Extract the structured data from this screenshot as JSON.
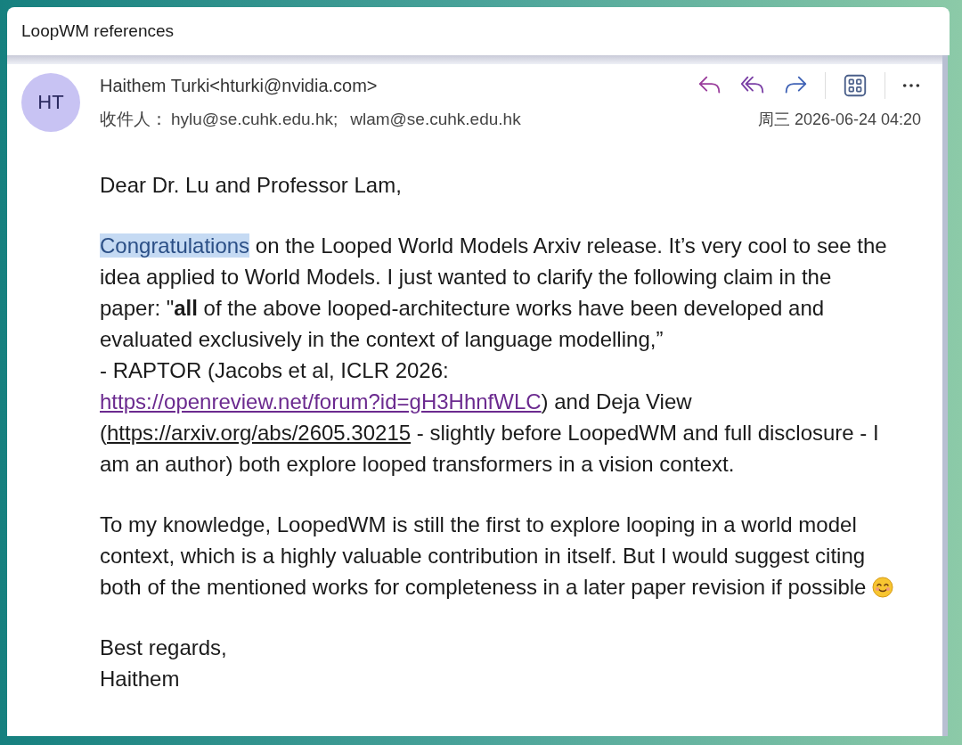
{
  "window": {
    "title": "LoopWM references"
  },
  "message": {
    "sender": {
      "initials": "HT",
      "name": "Haithem Turki<hturki@nvidia.com>"
    },
    "recipients_label": "收件人：",
    "recipients": [
      "hylu@se.cuhk.edu.hk;",
      "wlam@se.cuhk.edu.hk"
    ],
    "date": "周三 2026-06-24 04:20",
    "body": [
      {
        "segments": [
          {
            "kind": "text",
            "text": "Dear Dr. Lu and Professor Lam,"
          }
        ]
      },
      {
        "segments": [
          {
            "kind": "highlight",
            "text": "Congratulations"
          },
          {
            "kind": "text",
            "text": " on the Looped World Models Arxiv release. It’s very cool to see the idea applied to World Models. I just wanted to clarify the following claim in the paper: \"**all** of the above looped-architecture works have been developed and evaluated exclusively in the context of language modelling,”"
          },
          {
            "kind": "break"
          },
          {
            "kind": "text",
            "text": "- RAPTOR (Jacobs et al, ICLR 2026: "
          },
          {
            "kind": "link",
            "text": "https://openreview.net/forum?id=gH3HhnfWLC",
            "visited": true
          },
          {
            "kind": "text",
            "text": ") and Deja View ("
          },
          {
            "kind": "link",
            "text": "https://arxiv.org/abs/2605.30215",
            "visited": false
          },
          {
            "kind": "text",
            "text": " - slightly before LoopedWM and full disclosure - I am an author) both explore looped transformers in a vision context."
          }
        ]
      },
      {
        "segments": [
          {
            "kind": "text",
            "text": "To my knowledge, LoopedWM is still the first to explore looping in a world model context, which is a highly valuable contribution in itself. But I would suggest citing both of the mentioned works for completeness in a later paper revision if possible "
          },
          {
            "kind": "emoji"
          }
        ]
      },
      {
        "segments": [
          {
            "kind": "text",
            "text": "Best regards,"
          },
          {
            "kind": "break"
          },
          {
            "kind": "text",
            "text": "Haithem"
          }
        ]
      }
    ]
  }
}
